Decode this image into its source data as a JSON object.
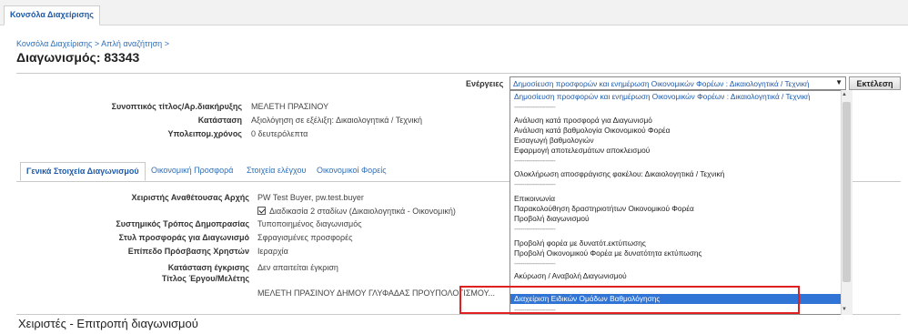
{
  "top_tab": "Κονσόλα Διαχείρισης",
  "breadcrumb": [
    "Κονσόλα Διαχείρισης",
    ">",
    "Απλή αναζήτηση",
    ">"
  ],
  "page_title": "Διαγωνισμός: 83343",
  "actions": {
    "label": "Ενέργειες",
    "selected": "Δημοσίευση προσφορών και ενημέρωση Οικονομικών Φορέων : Δικαιολογητικά / Τεχνική",
    "execute_label": "Εκτέλεση"
  },
  "summary": {
    "title_label": "Συνοπτικός τίτλος/Αρ.διακήρυξης",
    "title_value": "ΜΕΛΕΤΗ ΠΡΑΣΙΝΟΥ",
    "status_label": "Κατάσταση",
    "status_value": "Αξιολόγηση σε εξέλιξη: Δικαιολογητικά / Τεχνική",
    "remaining_label": "Υπολειπομ.χρόνος",
    "remaining_value": "0 δευτερόλεπτα"
  },
  "tabs": [
    "Γενικά Στοιχεία Διαγωνισμού",
    "Οικονομική Προσφορά",
    "Στοιχεία ελέγχου",
    "Οικονομικοί Φορείς"
  ],
  "details": {
    "manager_label": "Χειριστής Αναθέτουσας Αρχής",
    "manager_value": "PW Test Buyer, pw.test.buyer",
    "two_stage_label": "Διαδικασία 2 σταδίων (Δικαιολογητικά - Οικονομική)",
    "method_label": "Συστημικός Τρόπος Δημοπρασίας",
    "method_value": "Τυποποιημένος διαγωνισμός",
    "style_label": "Στυλ προσφοράς για Διαγωνισμό",
    "style_value": "Σφραγισμένες προσφορές",
    "access_label": "Επίπεδο Πρόσβασης Χρηστών",
    "access_value": "Ιεραρχία",
    "approval_label": "Κατάσταση έγκρισης",
    "approval_value": "Δεν απαιτείται έγκριση",
    "project_label": "Τίτλος Έργου/Μελέτης",
    "project_value": "ΜΕΛΕΤΗ ΠΡΑΣΙΝΟΥ ΔΗΜΟΥ ΓΛΥΦΑΔΑΣ ΠΡΟΥΠΟΛΟΓΙΣΜΟΥ..."
  },
  "section_title": "Χειριστές - Επιτροπή διαγωνισμού",
  "dropdown_items": [
    "Δημοσίευση προσφορών και ενημέρωση Οικονομικών Φορέων : Δικαιολογητικά / Τεχνική",
    "--------------------",
    "Ανάλυση κατά προσφορά για Διαγωνισμό",
    "Ανάλυση κατά βαθμολογία Οικονομικού Φορέα",
    "Εισαγωγή βαθμολογιών",
    "Εφαρμογή αποτελεσμάτων αποκλεισμού",
    "--------------------",
    "Ολοκλήρωση αποσφράγισης φακέλου: Δικαιολογητικά / Τεχνική",
    "--------------------",
    "Επικοινωνία",
    "Παρακολούθηση δραστηριοτήτων Οικονομικού Φορέα",
    "Προβολή διαγωνισμού",
    "--------------------",
    "Προβολή φορέα με δυνατότ.εκτύπωσης",
    "Προβολή Οικονομικού Φορέα με δυνατότητα εκτύπωσης",
    "--------------------",
    "Ακύρωση / Αναβολή Διαγωνισμού",
    "--------------------",
    "Διαχείριση Ειδικών Ομάδων Βαθμολόγησης",
    "--------------------"
  ],
  "icons": {
    "select_arrow": "dropdown-arrow-icon",
    "checkbox": "checkbox-checked-icon"
  }
}
